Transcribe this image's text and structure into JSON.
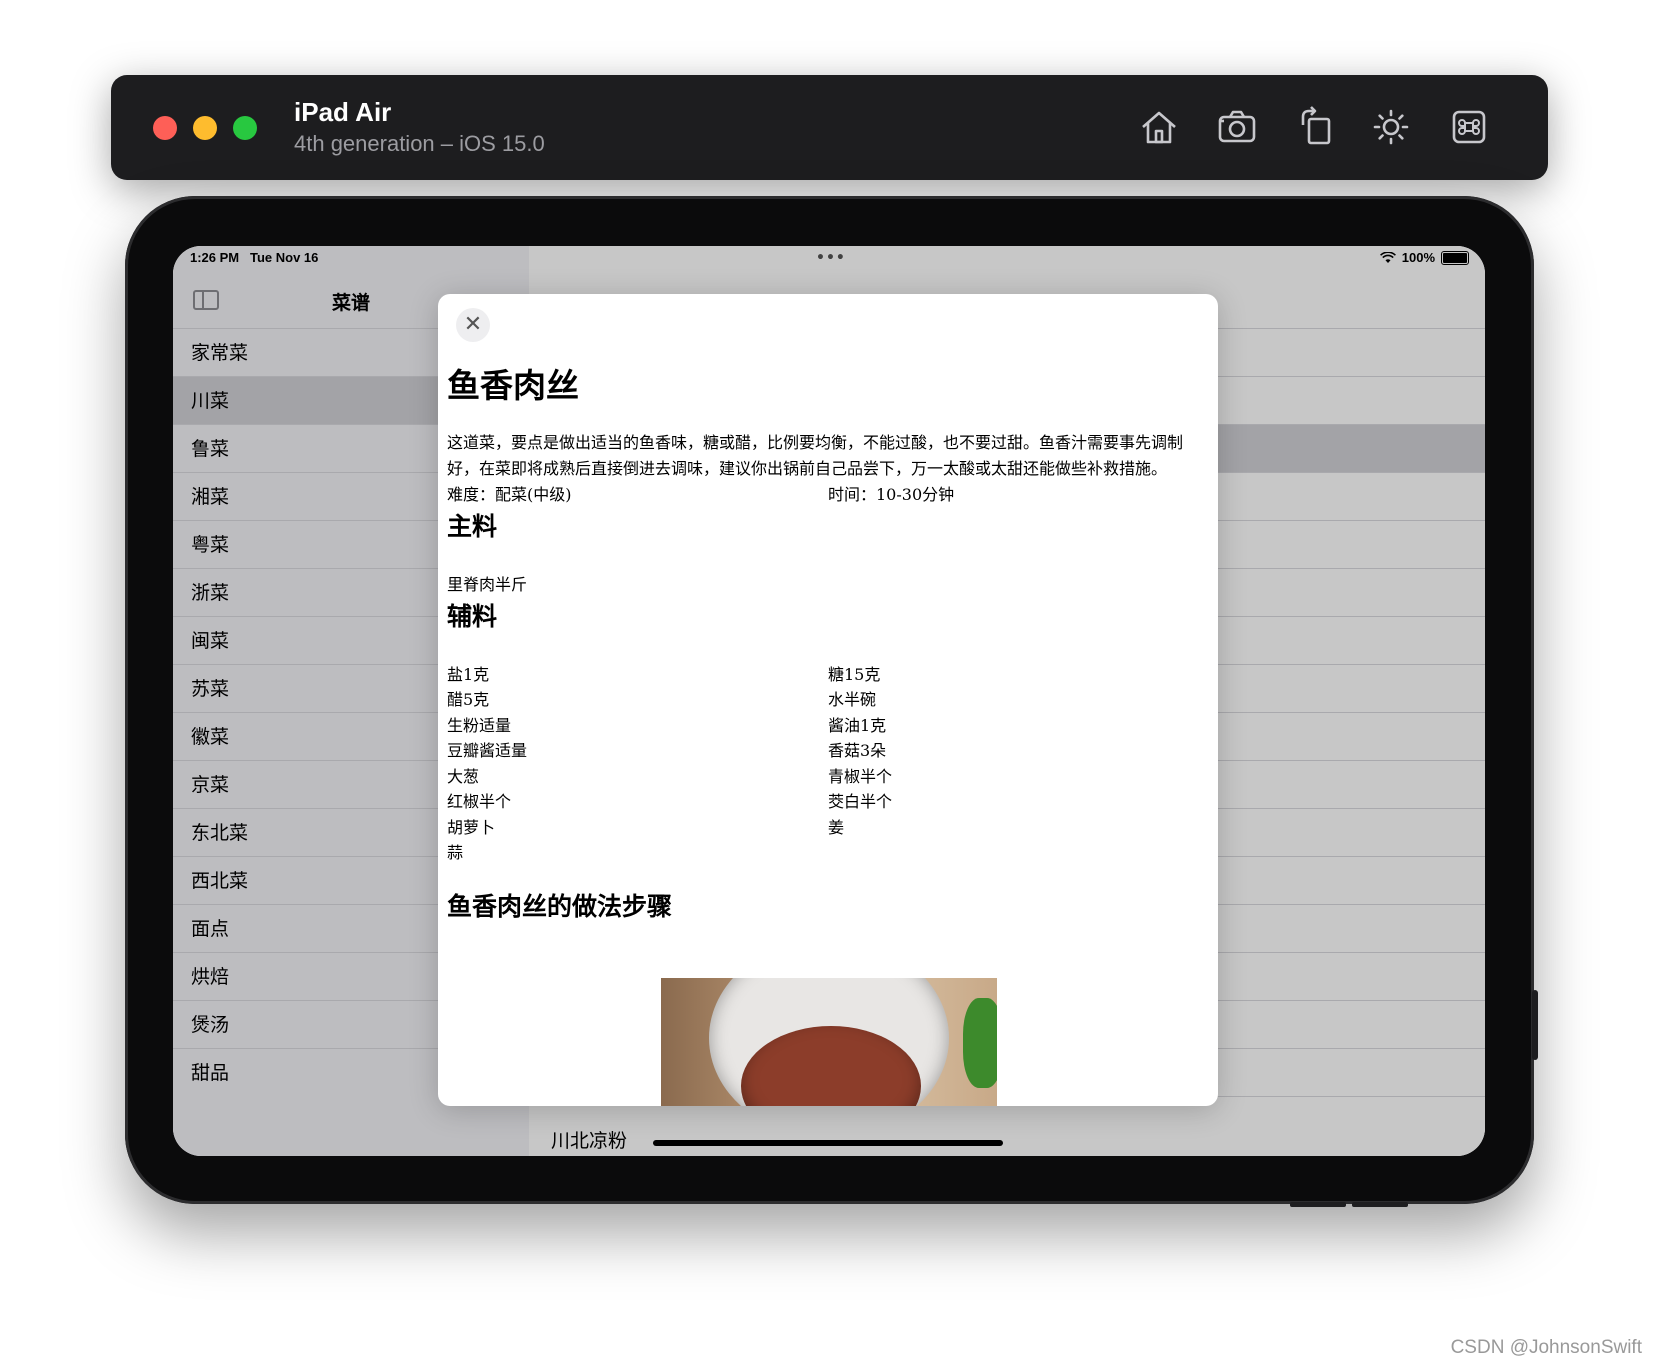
{
  "simulator": {
    "title": "iPad Air",
    "subtitle": "4th generation – iOS 15.0",
    "toolbar_icons": [
      "home-icon",
      "screenshot-icon",
      "rotate-icon",
      "appearance-icon",
      "shortcut-icon"
    ]
  },
  "status_bar": {
    "time": "1:26 PM",
    "date": "Tue Nov 16",
    "battery": "100%",
    "dots": "•••"
  },
  "sidebar": {
    "title": "菜谱",
    "selected_index": 1,
    "items": [
      "家常菜",
      "川菜",
      "鲁菜",
      "湘菜",
      "粤菜",
      "浙菜",
      "闽菜",
      "苏菜",
      "徽菜",
      "京菜",
      "东北菜",
      "西北菜",
      "面点",
      "烘焙",
      "煲汤",
      "甜品"
    ]
  },
  "detail": {
    "bottom_visible_item": "川北凉粉"
  },
  "modal": {
    "close_symbol": "✕",
    "title": "鱼香肉丝",
    "intro": "这道菜，要点是做出适当的鱼香味，糖或醋，比例要均衡，不能过酸，也不要过甜。鱼香汁需要事先调制好，在菜即将成熟后直接倒进去调味，建议你出锅前自己品尝下，万一太酸或太甜还能做些补救措施。",
    "difficulty": "难度：配菜(中级)",
    "time": "时间：10-30分钟",
    "main_heading": "主料",
    "main_ingredients": [
      "里脊肉半斤"
    ],
    "aux_heading": "辅料",
    "aux_ingredients": [
      "盐1克",
      "糖15克",
      "醋5克",
      "水半碗",
      "生粉适量",
      "酱油1克",
      "豆瓣酱适量",
      "香菇3朵",
      "大葱",
      "青椒半个",
      "红椒半个",
      "茭白半个",
      "胡萝卜",
      "姜",
      "蒜"
    ],
    "steps_heading": "鱼香肉丝的做法步骤"
  },
  "watermark": "CSDN @JohnsonSwift",
  "colors": {
    "titlebar_bg": "#1d1d1f",
    "traffic_red": "#fe5f57",
    "traffic_yellow": "#febc2e",
    "traffic_green": "#28c840"
  }
}
